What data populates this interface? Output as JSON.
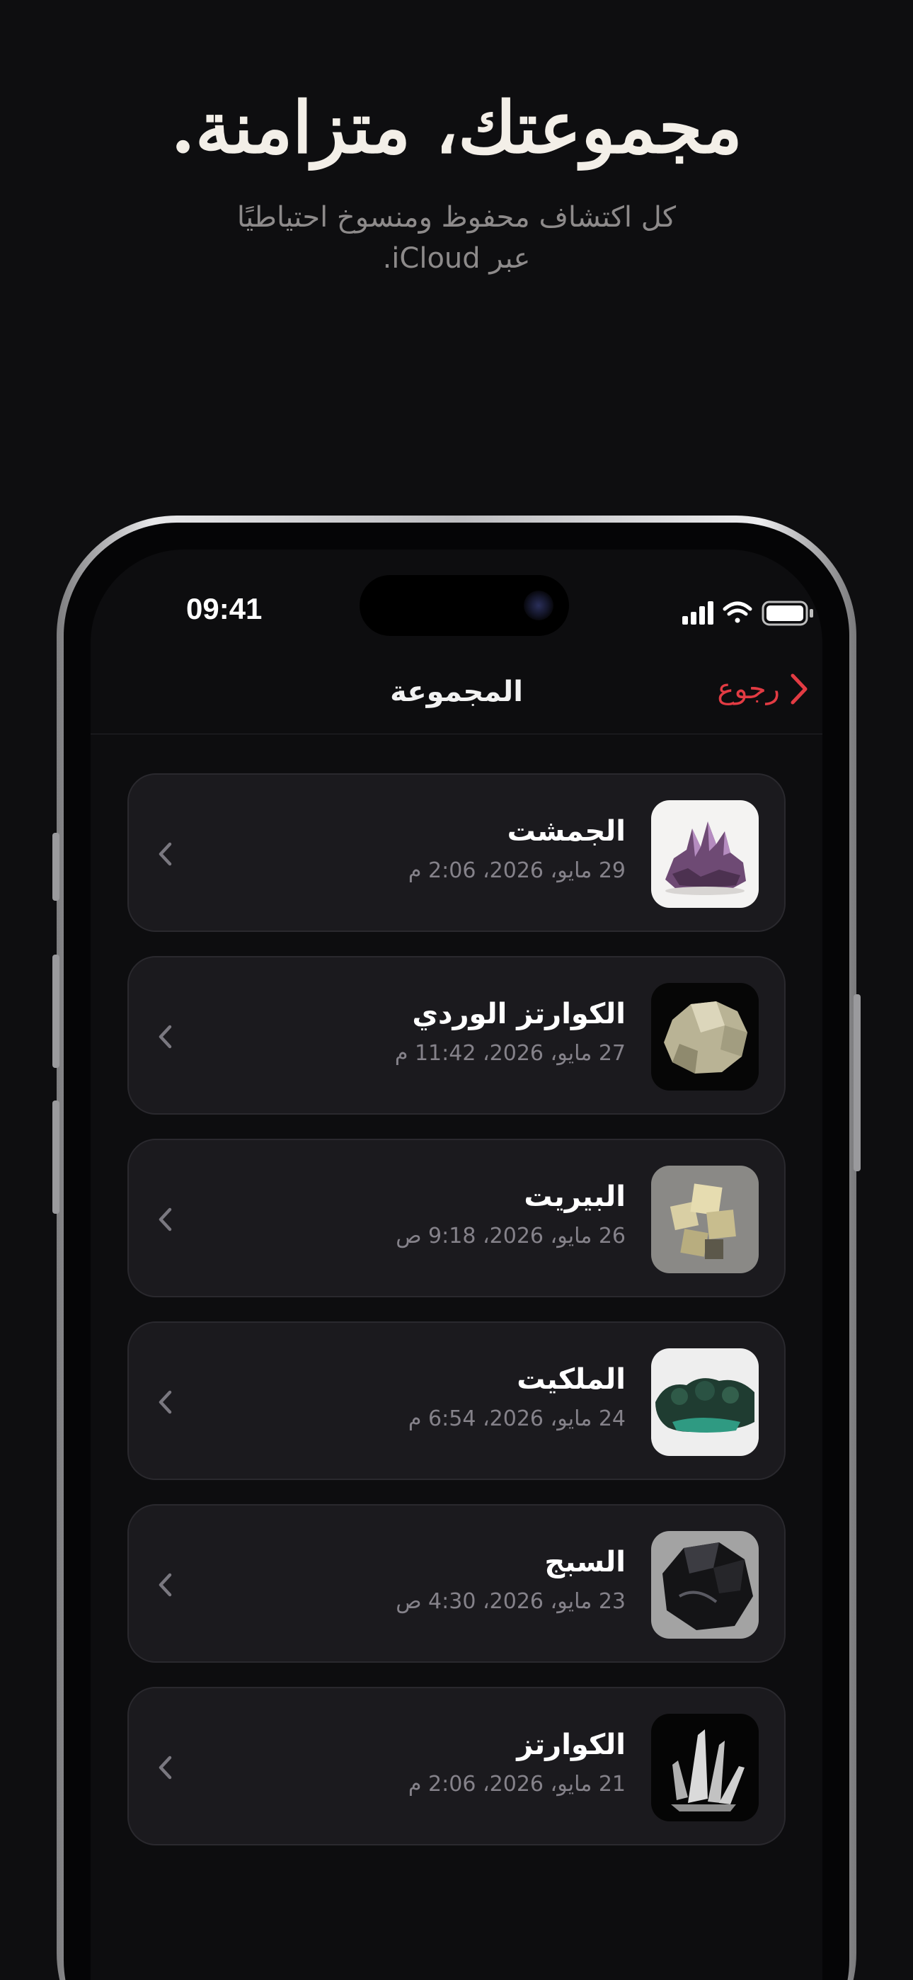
{
  "headline": "مجموعتك، متزامنة.",
  "subheadline": {
    "line1": "كل اكتشاف محفوظ ومنسوخ احتياطيًا",
    "line2": "عبر iCloud."
  },
  "status_bar": {
    "time": "09:41",
    "icons": [
      "signal-icon",
      "wifi-icon",
      "battery-icon"
    ]
  },
  "nav": {
    "title": "المجموعة",
    "back_label": "رجوع"
  },
  "colors": {
    "accent": "#e23b43",
    "background": "#0e0e10",
    "card": "#1b1a1e"
  },
  "items": [
    {
      "name": "الجمشت",
      "date": "29 مايو، 2026، 2:06 م",
      "image": "amethyst-photo"
    },
    {
      "name": "الكوارتز الوردي",
      "date": "27 مايو، 2026، 11:42 م",
      "image": "rose-quartz-photo"
    },
    {
      "name": "البيريت",
      "date": "26 مايو، 2026، 9:18 ص",
      "image": "pyrite-photo"
    },
    {
      "name": "الملكيت",
      "date": "24 مايو، 2026، 6:54 م",
      "image": "malachite-photo"
    },
    {
      "name": "السبج",
      "date": "23 مايو، 2026، 4:30 ص",
      "image": "obsidian-photo"
    },
    {
      "name": "الكوارتز",
      "date": "21 مايو، 2026، 2:06 م",
      "image": "quartz-photo"
    }
  ]
}
